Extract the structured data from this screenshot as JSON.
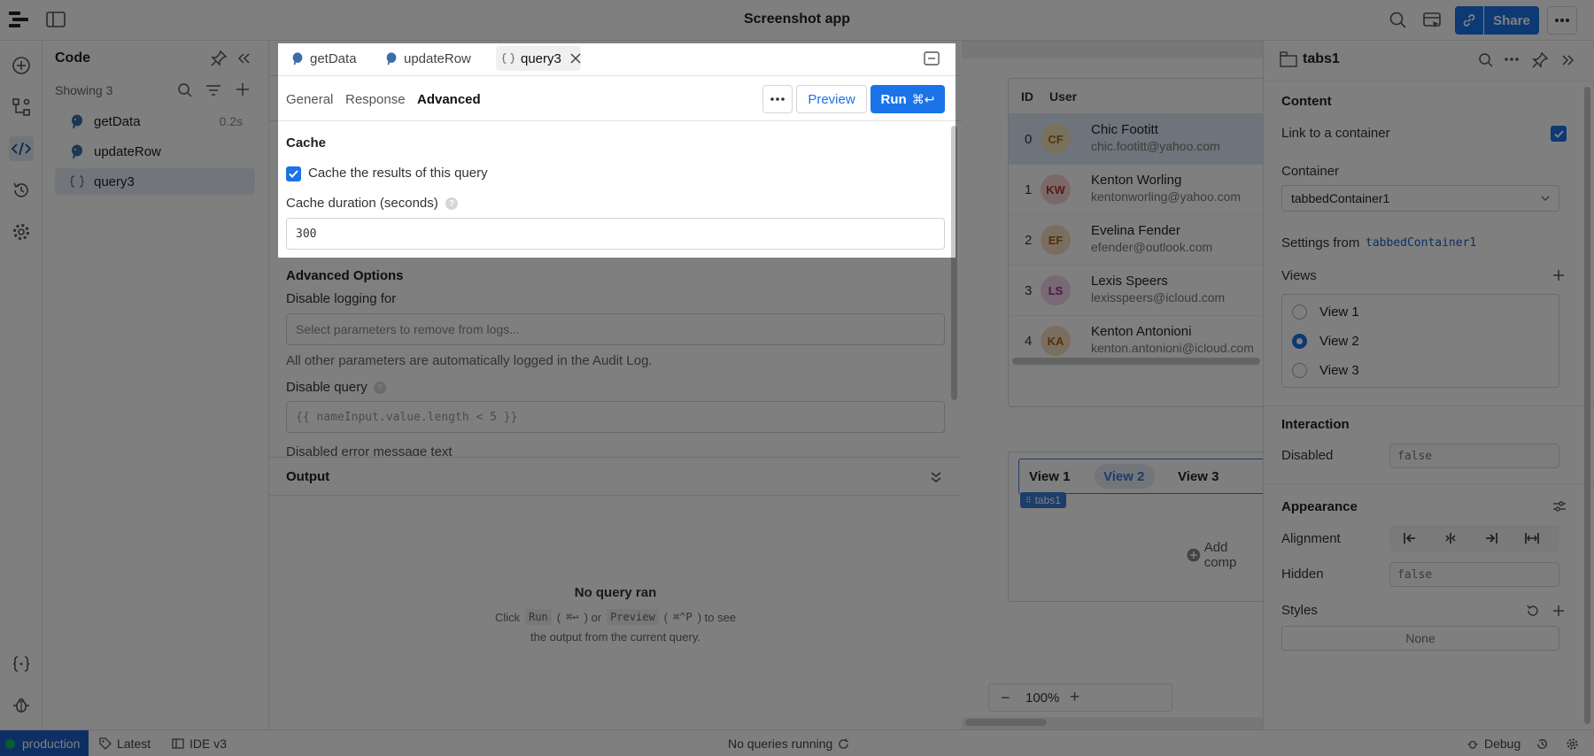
{
  "app": {
    "title": "Screenshot app",
    "share_label": "Share"
  },
  "code_panel": {
    "title": "Code",
    "showing": "Showing 3",
    "queries": [
      {
        "name": "getData",
        "time": "0.2s"
      },
      {
        "name": "updateRow",
        "time": ""
      },
      {
        "name": "query3",
        "time": ""
      }
    ]
  },
  "editor": {
    "tabs": [
      {
        "label": "getData"
      },
      {
        "label": "updateRow"
      },
      {
        "label": "query3"
      }
    ],
    "subtabs": [
      {
        "label": "General"
      },
      {
        "label": "Response"
      },
      {
        "label": "Advanced"
      }
    ],
    "preview_label": "Preview",
    "run_label": "Run",
    "run_shortcut": "⌘↩",
    "cache": {
      "title": "Cache",
      "checkbox_label": "Cache the results of this query",
      "duration_label": "Cache duration (seconds)",
      "duration_value": "300"
    },
    "advanced": {
      "title": "Advanced Options",
      "disable_logging_label": "Disable logging for",
      "disable_logging_placeholder": "Select parameters to remove from logs...",
      "logging_note": "All other parameters are automatically logged in the Audit Log.",
      "disable_query_label": "Disable query",
      "disable_query_placeholder": "{{ nameInput.value.length < 5 }}",
      "error_text_label": "Disabled error message text"
    },
    "output": {
      "title": "Output",
      "empty_title": "No query ran",
      "hint_click": "Click",
      "hint_run": "Run",
      "hint_run_key": "⌘↩",
      "hint_or": ") or",
      "hint_preview": "Preview",
      "hint_preview_key": "⌘^P",
      "hint_end": ") to see",
      "hint_line2": "the output from the current query."
    }
  },
  "canvas": {
    "table": {
      "headers": [
        "ID",
        "User"
      ],
      "rows": [
        {
          "id": "0",
          "initials": "CF",
          "name": "Chic Footitt",
          "email": "chic.footitt@yahoo.com",
          "bg": "#f5e3b8",
          "fg": "#a06a10"
        },
        {
          "id": "1",
          "initials": "KW",
          "name": "Kenton Worling",
          "email": "kentonworling@yahoo.com",
          "bg": "#f6d2d2",
          "fg": "#b0323a"
        },
        {
          "id": "2",
          "initials": "EF",
          "name": "Evelina Fender",
          "email": "efender@outlook.com",
          "bg": "#f5dcc0",
          "fg": "#a85c18"
        },
        {
          "id": "3",
          "initials": "LS",
          "name": "Lexis Speers",
          "email": "lexisspeers@icloud.com",
          "bg": "#f3d3e8",
          "fg": "#a0307c"
        },
        {
          "id": "4",
          "initials": "KA",
          "name": "Kenton Antonioni",
          "email": "kenton.antonioni@icloud.com",
          "bg": "#f5dcc0",
          "fg": "#a85c18"
        }
      ]
    },
    "tabs": [
      {
        "label": "View 1"
      },
      {
        "label": "View 2"
      },
      {
        "label": "View 3"
      }
    ],
    "component_tag": "tabs1",
    "add_component": "Add comp",
    "zoom": "100%"
  },
  "inspector": {
    "title": "tabs1",
    "content_title": "Content",
    "link_label": "Link to a container",
    "container_label": "Container",
    "container_value": "tabbedContainer1",
    "settings_from": "Settings from",
    "settings_link": "tabbedContainer1",
    "views_label": "Views",
    "views": [
      {
        "label": "View 1"
      },
      {
        "label": "View 2"
      },
      {
        "label": "View 3"
      }
    ],
    "interaction_title": "Interaction",
    "disabled_label": "Disabled",
    "disabled_value": "false",
    "appearance_title": "Appearance",
    "alignment_label": "Alignment",
    "hidden_label": "Hidden",
    "hidden_value": "false",
    "styles_label": "Styles",
    "styles_value": "None"
  },
  "status": {
    "env": "production",
    "latest": "Latest",
    "ide": "IDE v3",
    "queries": "No queries running",
    "debug": "Debug"
  },
  "colors": {
    "accent": "#1a73e8",
    "selected_row": "#dce8f6",
    "selected_item": "#e4ecf7"
  }
}
